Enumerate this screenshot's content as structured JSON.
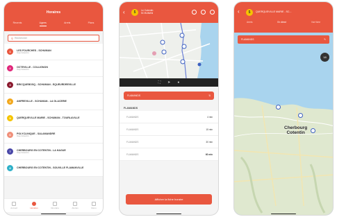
{
  "screen1": {
    "title": "Horaires",
    "tabs": [
      "Recents",
      "Lignes",
      "Arrets",
      "Plans"
    ],
    "active_tab": 1,
    "search_placeholder": "Rechercher",
    "lines": [
      {
        "num": "1",
        "color": "#e9573f",
        "name": "LES FOURCHES - SCHUMAN",
        "sub": "Cap Cotentin"
      },
      {
        "num": "2",
        "color": "#e0277a",
        "name": "OCTEVILLE - COLLIGNON",
        "sub": "Cap Cotentin"
      },
      {
        "num": "3",
        "color": "#8a1a2e",
        "name": "BRICQUEBOSQ - SCHUMAN - EQUEURDREVILLE",
        "sub": ""
      },
      {
        "num": "4",
        "color": "#f2a81d",
        "name": "AMFREVILLE - SCHUMAN - LA GLACERIE",
        "sub": ""
      },
      {
        "num": "5",
        "color": "#f5c400",
        "name": "QUERQUEVILLE MARIE - SCHUMAN - TOURLAVILLE",
        "sub": ""
      },
      {
        "num": "6",
        "color": "#f0907a",
        "name": "POLYCLINIQUE - SALAMANDRE",
        "sub": "Cap Cotentin"
      },
      {
        "num": "7",
        "color": "#4a48a8",
        "name": "CHERBOURG EN COTENTIN - LA HAGUE",
        "sub": "Cap Cotentin"
      },
      {
        "num": "8",
        "color": "#2fb0c8",
        "name": "CHERBOURG EN COTENTIN - SOUVILLE FLAMANVILLE",
        "sub": ""
      }
    ],
    "bottom_nav": [
      "Accueil",
      "Horaires",
      "Itineraire",
      "Alertes",
      "Menu"
    ],
    "active_nav": 1
  },
  "screen2": {
    "badge": "5",
    "header_line1": "Le Cotentin",
    "header_line2": "SCHUMAN",
    "direction": "FLAMANDS",
    "section": "FLAMANDS",
    "stops": [
      {
        "name": "FLAMANDS",
        "time": "4 min"
      },
      {
        "name": "FLAMANDS",
        "time": "15 min"
      },
      {
        "name": "FLAMANDS",
        "time": "30 min"
      },
      {
        "name": "FLAMANDS",
        "time": "60 min"
      }
    ],
    "cta": "Afficher la fiche horaire"
  },
  "screen3": {
    "badge": "5",
    "header": "QUERQUEVILLE MARIE - SC...",
    "tabs": [
      "Arrets",
      "En direct",
      "Voir fiche"
    ],
    "active_tab": 1,
    "filter": "FLAMANDS",
    "count": "18",
    "city_line1": "Cherbourg",
    "city_line2": "Cotentin"
  },
  "colors": {
    "accent": "#e9573f",
    "badge_yellow": "#f5c400",
    "sea": "#a9d4ee",
    "land": "#dfe8cf"
  }
}
